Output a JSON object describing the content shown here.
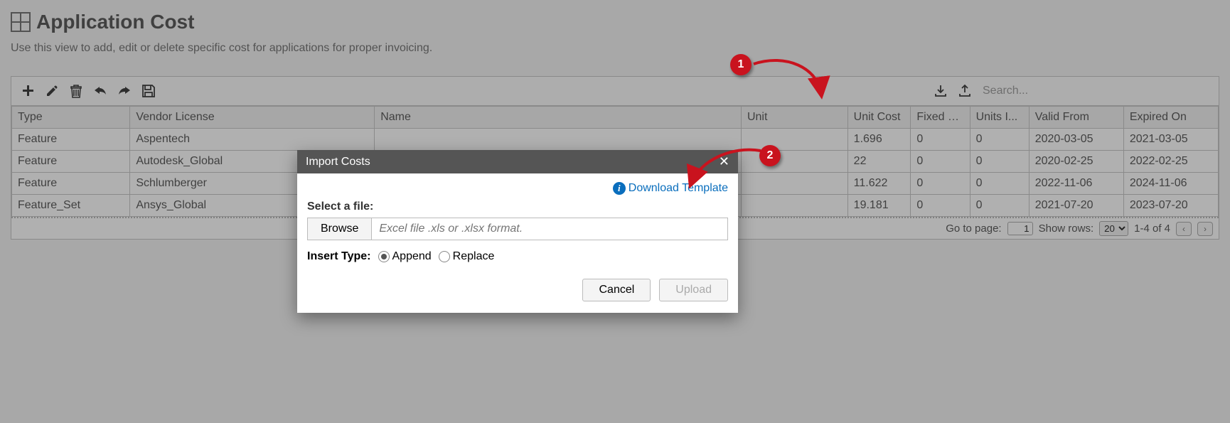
{
  "page": {
    "title": "Application Cost",
    "description": "Use this view to add, edit or delete specific cost for applications for proper invoicing."
  },
  "toolbar": {
    "search_placeholder": "Search..."
  },
  "table": {
    "headers": {
      "type": "Type",
      "vendor_license": "Vendor License",
      "name": "Name",
      "unit": "Unit",
      "unit_cost": "Unit Cost",
      "fixed_cost": "Fixed C...",
      "units_invoiced": "Units I...",
      "valid_from": "Valid From",
      "expired_on": "Expired On"
    },
    "rows": [
      {
        "type": "Feature",
        "vendor_license": "Aspentech",
        "name": "",
        "unit": "",
        "unit_cost": "1.696",
        "fixed_cost": "0",
        "units_invoiced": "0",
        "valid_from": "2020-03-05",
        "expired_on": "2021-03-05"
      },
      {
        "type": "Feature",
        "vendor_license": "Autodesk_Global",
        "name": "",
        "unit": "",
        "unit_cost": "22",
        "fixed_cost": "0",
        "units_invoiced": "0",
        "valid_from": "2020-02-25",
        "expired_on": "2022-02-25"
      },
      {
        "type": "Feature",
        "vendor_license": "Schlumberger",
        "name": "",
        "unit": "",
        "unit_cost": "11.622",
        "fixed_cost": "0",
        "units_invoiced": "0",
        "valid_from": "2022-11-06",
        "expired_on": "2024-11-06"
      },
      {
        "type": "Feature_Set",
        "vendor_license": "Ansys_Global",
        "name": "",
        "unit": "",
        "unit_cost": "19.181",
        "fixed_cost": "0",
        "units_invoiced": "0",
        "valid_from": "2021-07-20",
        "expired_on": "2023-07-20"
      }
    ]
  },
  "pager": {
    "go_to_page_label": "Go to page:",
    "page_value": "1",
    "show_rows_label": "Show rows:",
    "rows_value": "20",
    "range_text": "1-4 of 4"
  },
  "dialog": {
    "title": "Import Costs",
    "download_link": "Download Template",
    "select_file_label": "Select a file:",
    "browse_label": "Browse",
    "file_placeholder": "Excel file .xls or .xlsx format.",
    "insert_type_label": "Insert Type:",
    "append_label": "Append",
    "replace_label": "Replace",
    "cancel_label": "Cancel",
    "upload_label": "Upload"
  },
  "annotations": {
    "one": "1",
    "two": "2"
  }
}
